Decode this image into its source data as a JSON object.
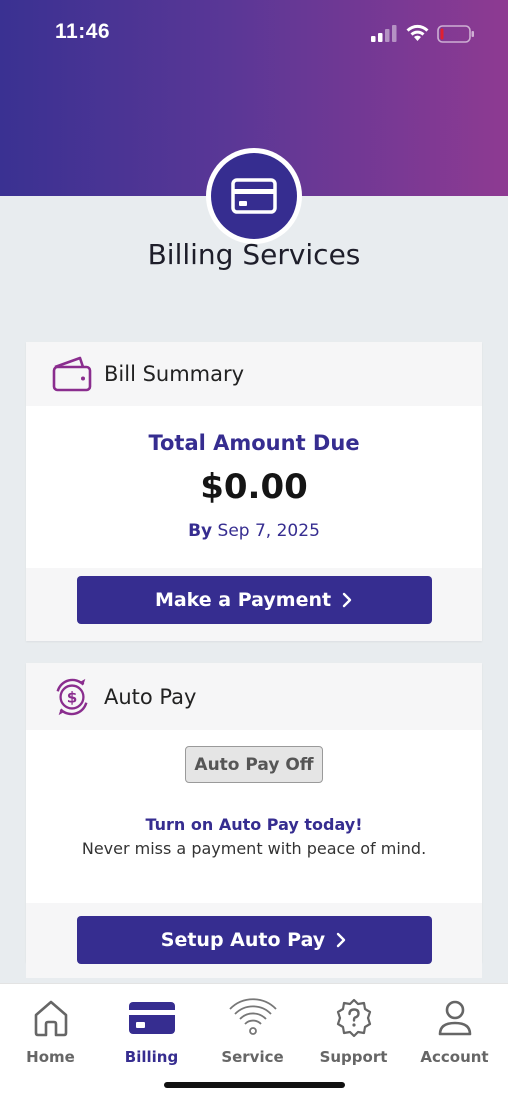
{
  "status_bar": {
    "time": "11:46"
  },
  "page": {
    "title": "Billing Services"
  },
  "bill_summary": {
    "header": "Bill Summary",
    "amount_label": "Total Amount Due",
    "amount": "$0.00",
    "due_prefix": "By",
    "due_date": "Sep 7, 2025",
    "button_label": "Make a Payment"
  },
  "auto_pay": {
    "header": "Auto Pay",
    "status_badge": "Auto Pay Off",
    "promo_title": "Turn on Auto Pay today!",
    "promo_subtitle": "Never miss a payment with peace of mind.",
    "button_label": "Setup Auto Pay"
  },
  "tabs": [
    {
      "label": "Home",
      "icon": "home-icon",
      "active": false
    },
    {
      "label": "Billing",
      "icon": "credit-card-icon",
      "active": true
    },
    {
      "label": "Service",
      "icon": "wifi-icon",
      "active": false
    },
    {
      "label": "Support",
      "icon": "help-icon",
      "active": false
    },
    {
      "label": "Account",
      "icon": "person-icon",
      "active": false
    }
  ],
  "colors": {
    "brand_primary": "#362d90",
    "header_gradient_start": "#3a3192",
    "header_gradient_end": "#8e3a92",
    "accent_icon": "#8a2d8e",
    "background": "#e8ecef"
  }
}
